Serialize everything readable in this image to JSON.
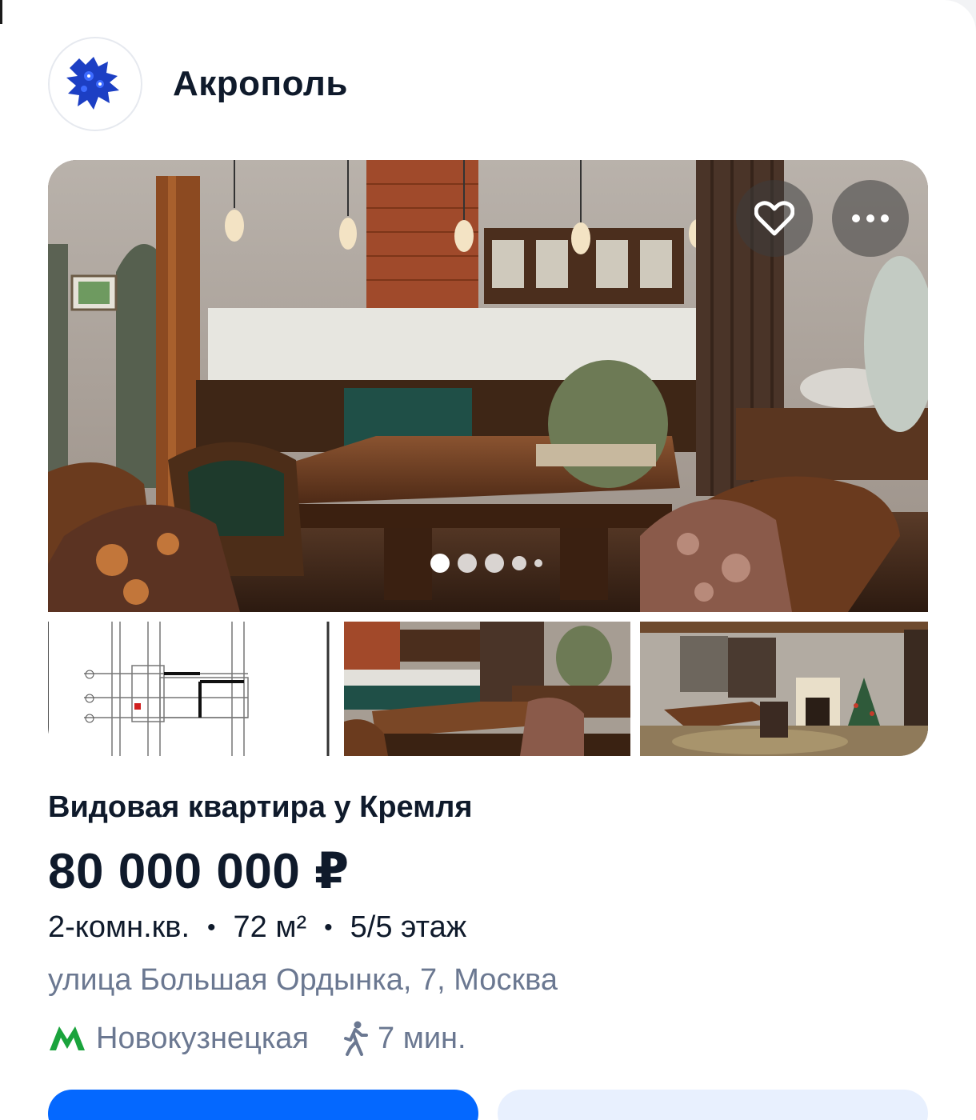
{
  "agency": {
    "name": "Акрополь",
    "logo_icon": "gzhel-bird-icon"
  },
  "gallery": {
    "favorite_icon": "heart-icon",
    "more_icon": "more-dots-icon",
    "dots_count": 5,
    "active_dot": 1,
    "thumbnails": [
      "floor-plan",
      "kitchen-dining",
      "living-room"
    ]
  },
  "listing": {
    "title": "Видовая квартира у Кремля",
    "price": "80 000 000 ₽",
    "rooms": "2-комн.кв.",
    "area": "72 м²",
    "floor": "5/5 этаж",
    "separator": "•",
    "address": "улица Большая Ордынка, 7, Москва",
    "metro_station": "Новокузнецкая",
    "walk_time": "7 мин."
  },
  "colors": {
    "primary": "#0468ff",
    "text": "#0f1a2b",
    "muted": "#6b7891",
    "metro": "#1aa33c"
  }
}
